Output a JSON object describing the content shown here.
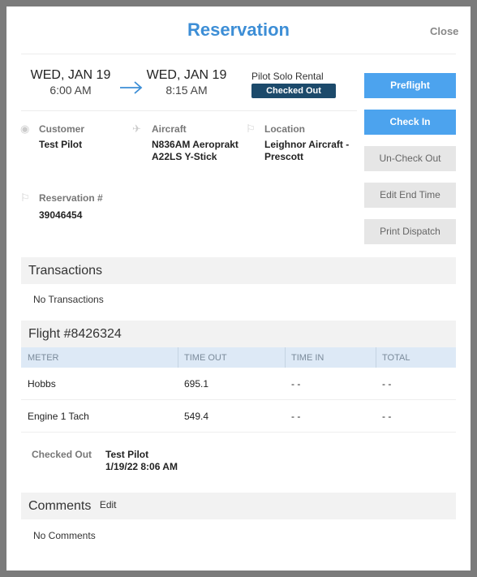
{
  "modal": {
    "title": "Reservation",
    "close_label": "Close"
  },
  "schedule": {
    "start_date": "WED, JAN 19",
    "start_time": "6:00 AM",
    "end_date": "WED, JAN 19",
    "end_time": "8:15 AM",
    "type": "Pilot Solo Rental",
    "status": "Checked Out"
  },
  "details": {
    "customer": {
      "label": "Customer",
      "value": "Test Pilot"
    },
    "aircraft": {
      "label": "Aircraft",
      "value": "N836AM Aeroprakt A22LS Y-Stick"
    },
    "location": {
      "label": "Location",
      "value": "Leighnor Aircraft - Prescott"
    },
    "reservation": {
      "label": "Reservation #",
      "value": "39046454"
    }
  },
  "actions": {
    "preflight": "Preflight",
    "check_in": "Check In",
    "uncheck_out": "Un-Check Out",
    "edit_end_time": "Edit End Time",
    "print_dispatch": "Print Dispatch"
  },
  "transactions": {
    "title": "Transactions",
    "empty": "No Transactions"
  },
  "flight": {
    "title": "Flight #8426324",
    "columns": [
      "METER",
      "TIME OUT",
      "TIME IN",
      "TOTAL"
    ],
    "rows": [
      [
        "Hobbs",
        "695.1",
        "- -",
        "- -"
      ],
      [
        "Engine 1 Tach",
        "549.4",
        "- -",
        "- -"
      ]
    ],
    "checked_out_label": "Checked Out",
    "checked_out_by": "Test Pilot",
    "checked_out_at": "1/19/22 8:06 AM"
  },
  "comments": {
    "title": "Comments",
    "edit_label": "Edit",
    "empty": "No Comments"
  },
  "colors": {
    "accent": "#3d8ed6",
    "button_primary": "#4ca3ee",
    "badge": "#1c4a6b"
  }
}
